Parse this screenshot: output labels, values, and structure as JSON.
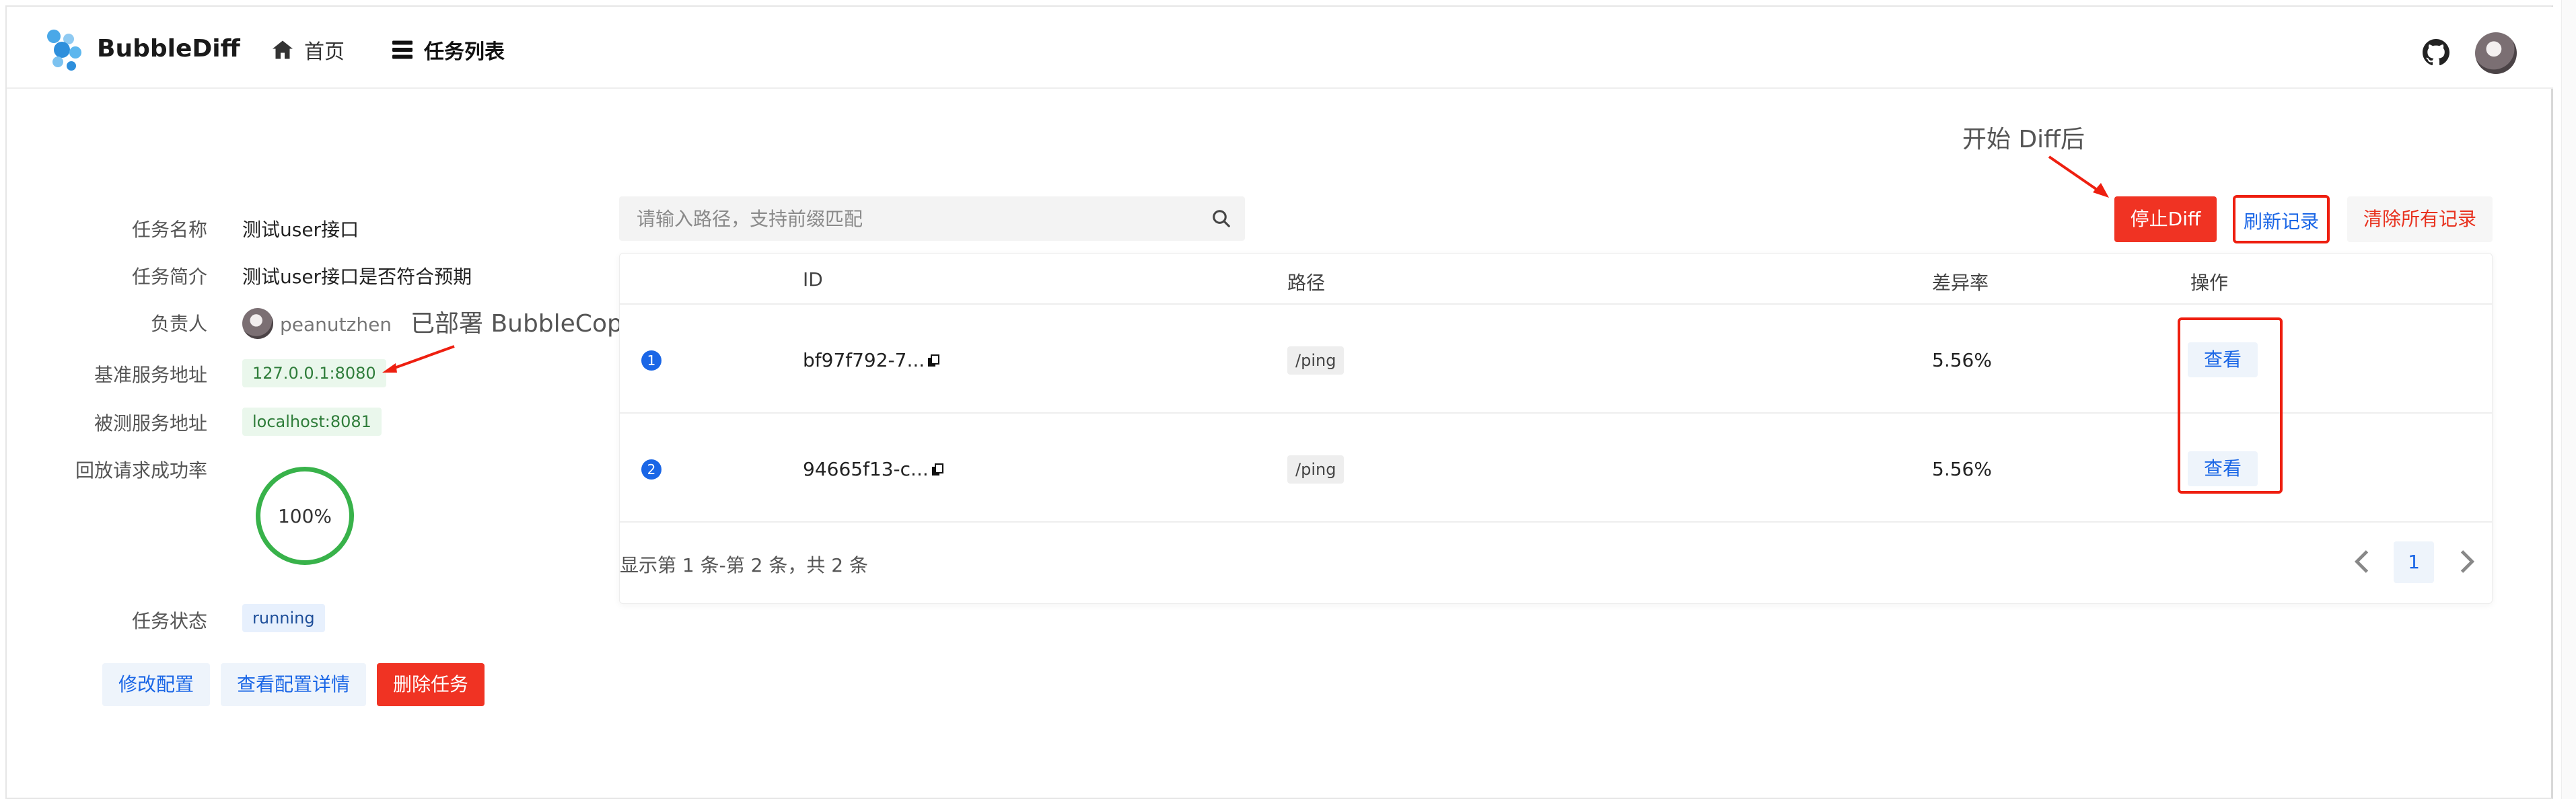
{
  "header": {
    "brand": "BubbleDiff",
    "nav": [
      {
        "label": "首页",
        "icon": "home-icon"
      },
      {
        "label": "任务列表",
        "icon": "list-icon"
      }
    ],
    "github_icon": "github-icon",
    "avatar": "user-avatar"
  },
  "task": {
    "name_label": "任务名称",
    "name_value": "测试user接口",
    "intro_label": "任务简介",
    "intro_value": "测试user接口是否符合预期",
    "owner_label": "负责人",
    "owner_value": "peanutzhen",
    "base_label": "基准服务地址",
    "base_value": "127.0.0.1:8080",
    "test_label": "被测服务地址",
    "test_value": "localhost:8081",
    "replay_label": "回放请求成功率",
    "replay_value": "100%",
    "replay_rate": 1.0,
    "status_label": "任务状态",
    "status_value": "running"
  },
  "task_actions": {
    "edit": "修改配置",
    "detail": "查看配置详情",
    "delete": "删除任务"
  },
  "annotations": {
    "deploy": "已部署 BubbleCopy",
    "start": "开始 Diff后"
  },
  "search": {
    "placeholder": "请输入路径，支持前缀匹配"
  },
  "toolbar": {
    "stop": "停止Diff",
    "refresh": "刷新记录",
    "clear": "清除所有记录"
  },
  "table": {
    "columns": [
      "ID",
      "路径",
      "差异率",
      "操作"
    ],
    "rows": [
      {
        "index": "1",
        "id": "bf97f792-7...",
        "path": "/ping",
        "rate": "5.56%",
        "action": "查看"
      },
      {
        "index": "2",
        "id": "94665f13-c...",
        "path": "/ping",
        "rate": "5.56%",
        "action": "查看"
      }
    ],
    "summary": "显示第 1 条-第 2 条，共 2 条",
    "page": "1"
  },
  "colors": {
    "primary": "#1a66e6",
    "danger": "#f03323",
    "success": "#38b24a",
    "annotation_red": "#ee1f10"
  }
}
